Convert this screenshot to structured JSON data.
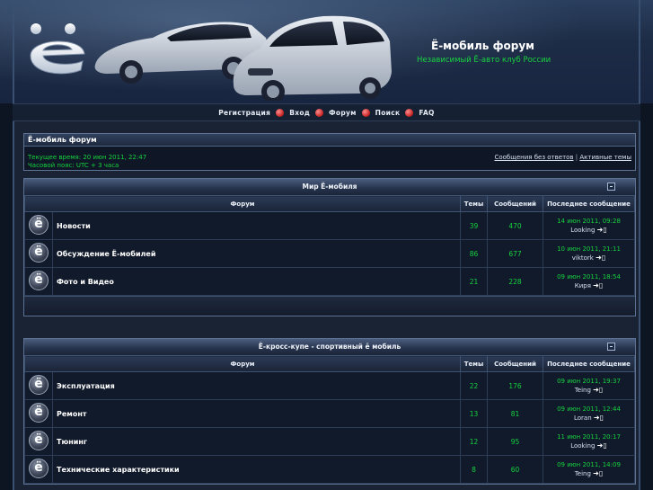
{
  "header": {
    "site_title": "Ё-мобиль форум",
    "site_subtitle": "Независимый Ё-авто клуб России"
  },
  "nav": {
    "register": "Регистрация",
    "login": "Вход",
    "forum": "Форум",
    "search": "Поиск",
    "faq": "FAQ"
  },
  "info": {
    "title": "Ё-мобиль форум",
    "current_time": "Текущее время: 20 июн 2011, 22:47",
    "timezone": "Часовой пояс: UTC + 3 часа",
    "unanswered_link": "Сообщения без ответов",
    "separator": "|",
    "active_link": "Активные темы"
  },
  "columns": {
    "forum": "Форум",
    "topics": "Темы",
    "posts": "Сообщений",
    "last_post": "Последнее сообщение"
  },
  "categories": [
    {
      "title": "Мир Ё-мобиля",
      "forums": [
        {
          "name": "Новости",
          "topics": "39",
          "posts": "470",
          "last_time": "14 июн 2011, 09:28",
          "last_user": "Looking"
        },
        {
          "name": "Обсуждение Ё-мобилей",
          "topics": "86",
          "posts": "677",
          "last_time": "10 июн 2011, 21:11",
          "last_user": "viktork"
        },
        {
          "name": "Фото и Видео",
          "topics": "21",
          "posts": "228",
          "last_time": "09 июн 2011, 18:54",
          "last_user": "Киря"
        }
      ]
    },
    {
      "title": "Ё-кросс-купе - спортивный ё мобиль",
      "forums": [
        {
          "name": "Эксплуатация",
          "topics": "22",
          "posts": "176",
          "last_time": "09 июн 2011, 19:37",
          "last_user": "Teing"
        },
        {
          "name": "Ремонт",
          "topics": "13",
          "posts": "81",
          "last_time": "09 июн 2011, 12:44",
          "last_user": "Loran"
        },
        {
          "name": "Тюнинг",
          "topics": "12",
          "posts": "95",
          "last_time": "11 июн 2011, 20:17",
          "last_user": "Looking"
        },
        {
          "name": "Технические характеристики",
          "topics": "8",
          "posts": "60",
          "last_time": "09 июн 2011, 14:09",
          "last_user": "Teing"
        }
      ]
    }
  ],
  "colors": {
    "accent_green": "#17d33e",
    "nav_dot_red": "#c22020",
    "background": "#0d1422"
  }
}
